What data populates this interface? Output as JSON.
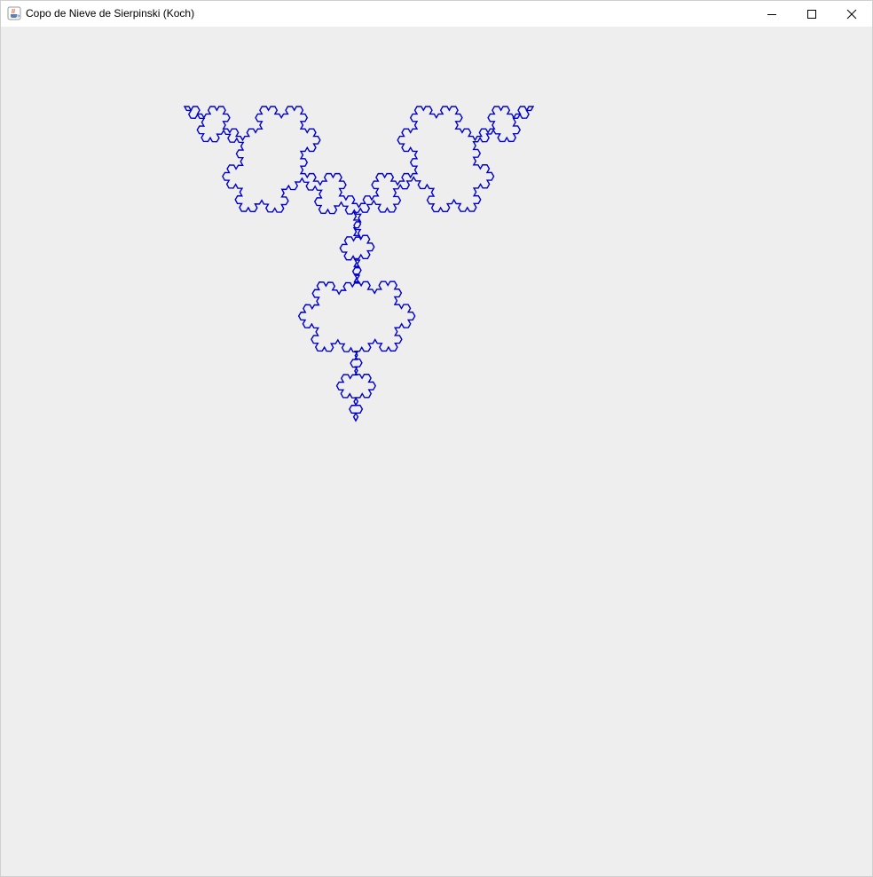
{
  "window": {
    "title": "Copo de Nieve de Sierpinski (Koch)",
    "icon": "java-cup-icon",
    "buttons": [
      "minimize-icon",
      "maximize-icon",
      "close-icon"
    ]
  },
  "canvas": {
    "background_color": "#eeeeee",
    "fractal": {
      "type": "koch-snowflake",
      "iterations": 4,
      "stroke_color": "#0000cc"
    }
  }
}
